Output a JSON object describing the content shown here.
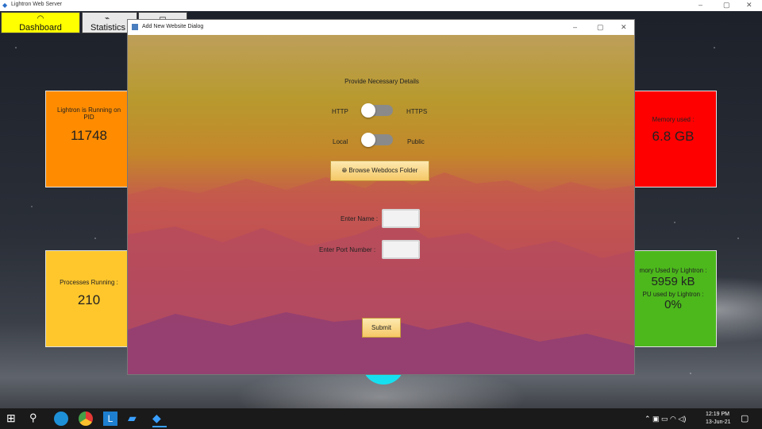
{
  "window": {
    "title": "Lightron Web Server",
    "minimize_glyph": "–",
    "maximize_glyph": "▢",
    "close_glyph": "✕"
  },
  "nav": {
    "tabs": [
      {
        "label": "Dashboard",
        "icon": "gauge-icon"
      },
      {
        "label": "Statistics",
        "icon": "chart-icon"
      },
      {
        "label": "",
        "icon": "document-icon"
      }
    ]
  },
  "cards": {
    "running": {
      "label": "Lightron is Running on",
      "label2": "PID",
      "value": "11748",
      "color": "#ff8c00"
    },
    "memory": {
      "label": "Memory used :",
      "value": "6.8 GB",
      "color": "#ff0000"
    },
    "processes": {
      "label": "Processes Running :",
      "value": "210",
      "color": "#ffc72c"
    },
    "usage": {
      "label": "mory Used by Lightron :",
      "value": "5959 kB",
      "label2": "PU used by Lightron :",
      "value2": "0%",
      "color": "#4cb81c"
    }
  },
  "dialog": {
    "title": "Add New Website Dialog",
    "heading": "Provide Necessary Details",
    "protocol": {
      "left": "HTTP",
      "right": "HTTPS",
      "selected": "HTTP"
    },
    "scope": {
      "left": "Local",
      "right": "Public",
      "selected": "Local"
    },
    "browse_label": "Browse Webdocs Folder",
    "name_label": "Enter Name :",
    "name_value": "",
    "port_label": "Enter Port Number :",
    "port_value": "",
    "submit_label": "Submit"
  },
  "taskbar": {
    "time": "12:19 PM",
    "date": "13-Jun-21"
  }
}
